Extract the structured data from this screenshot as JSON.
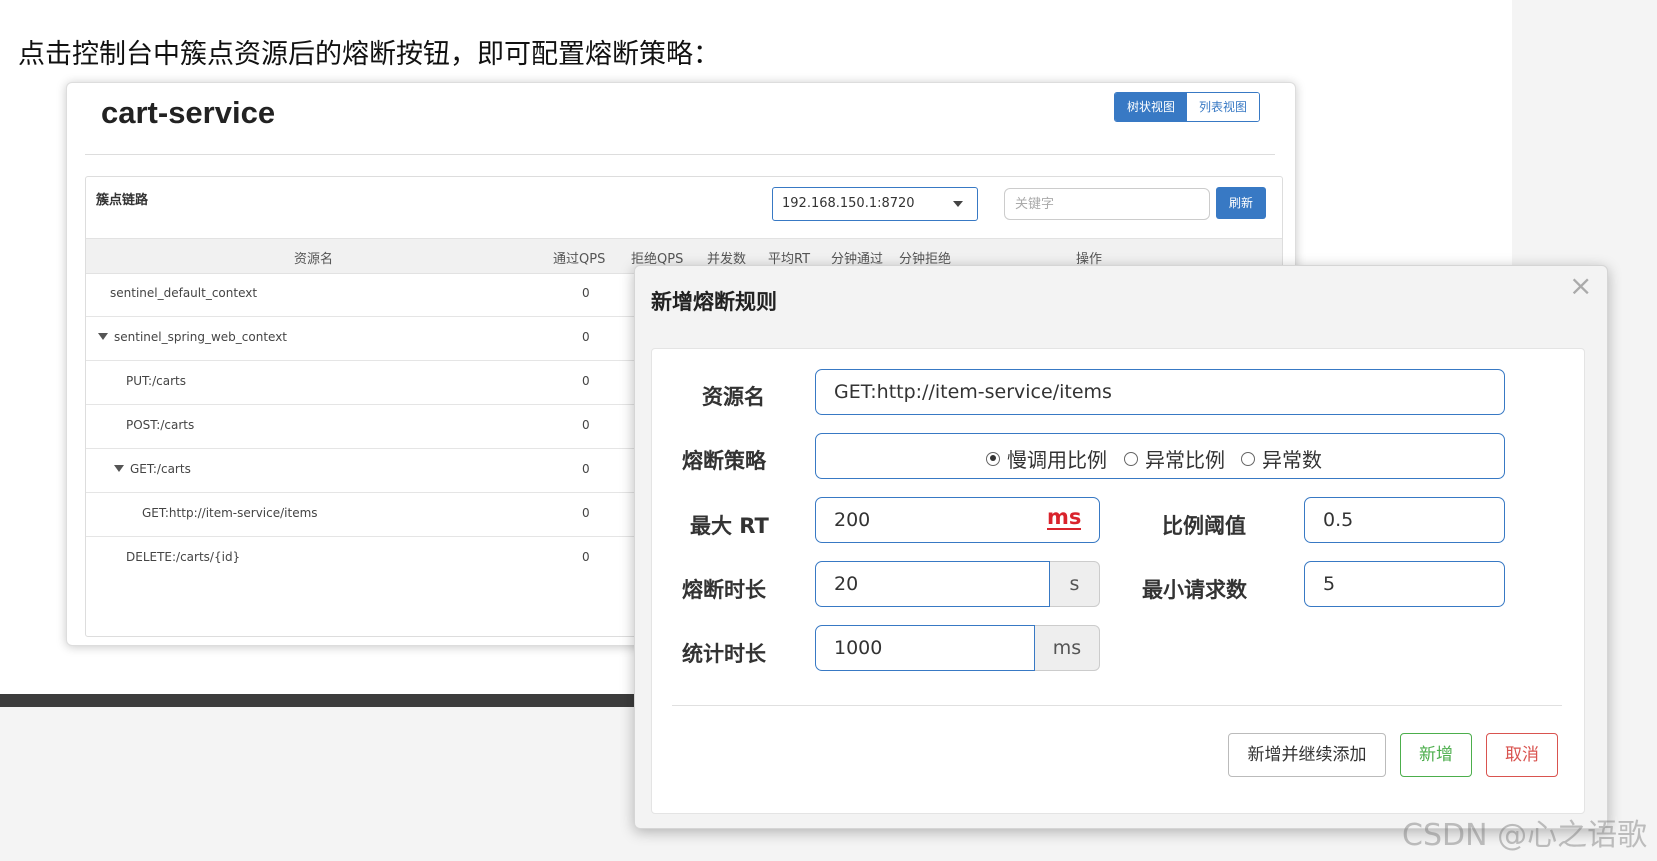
{
  "intro_text": "点击控制台中簇点资源后的熔断按钮，即可配置熔断策略：",
  "app": {
    "title": "cart-service",
    "view_tree": "树状视图",
    "view_list": "列表视图"
  },
  "panel": {
    "title": "簇点链路",
    "machine": "192.168.150.1:8720",
    "keyword_placeholder": "关键字",
    "refresh": "刷新"
  },
  "table": {
    "headers": [
      "资源名",
      "通过QPS",
      "拒绝QPS",
      "并发数",
      "平均RT",
      "分钟通过",
      "分钟拒绝",
      "操作"
    ],
    "rows": [
      {
        "name": "sentinel_default_context",
        "qps": "0"
      },
      {
        "name": "sentinel_spring_web_context",
        "qps": "0"
      },
      {
        "name": "PUT:/carts",
        "qps": "0"
      },
      {
        "name": "POST:/carts",
        "qps": "0"
      },
      {
        "name": "GET:/carts",
        "qps": "0"
      },
      {
        "name": "GET:http://item-service/items",
        "qps": "0"
      },
      {
        "name": "DELETE:/carts/{id}",
        "qps": "0"
      }
    ]
  },
  "modal": {
    "title": "新增熔断规则",
    "close": "×",
    "resource_label": "资源名",
    "resource_value": "GET:http://item-service/items",
    "strategy_label": "熔断策略",
    "strategies": [
      "慢调用比例",
      "异常比例",
      "异常数"
    ],
    "max_rt_label": "最大 RT",
    "max_rt_value": "200",
    "max_rt_unit": "ms",
    "ratio_label": "比例阈值",
    "ratio_value": "0.5",
    "duration_label": "熔断时长",
    "duration_value": "20",
    "duration_unit": "s",
    "min_request_label": "最小请求数",
    "min_request_value": "5",
    "stat_label": "统计时长",
    "stat_value": "1000",
    "stat_unit": "ms",
    "btn_continue": "新增并继续添加",
    "btn_add": "新增",
    "btn_cancel": "取消"
  },
  "watermark": "CSDN @心之语歌"
}
